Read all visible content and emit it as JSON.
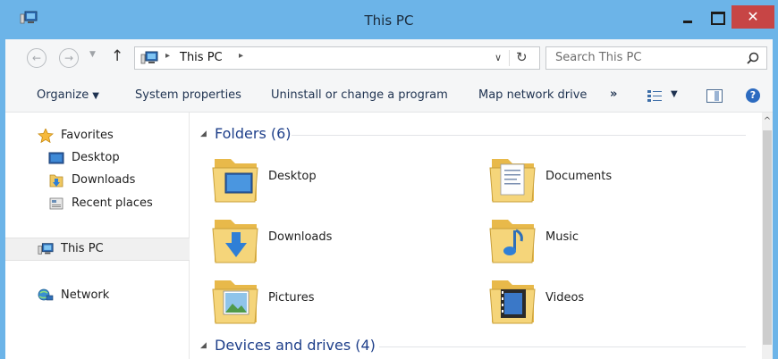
{
  "window": {
    "title": "This PC",
    "close_glyph": "✕",
    "accent_color": "#6cb4e8",
    "close_color": "#c74545"
  },
  "nav": {
    "back_glyph": "←",
    "forward_glyph": "→",
    "recent_glyph": "▼",
    "up_glyph": "↑",
    "address_sep": "▸",
    "address_text": "This PC",
    "address_dropdown_glyph": "∨",
    "refresh_glyph": "↻",
    "search_placeholder": "Search This PC"
  },
  "command_bar": {
    "organize": "Organize",
    "organize_caret": "▼",
    "system_properties": "System properties",
    "uninstall": "Uninstall or change a program",
    "map_drive": "Map network drive",
    "more": "»",
    "view_caret": "▼",
    "help": "?"
  },
  "sidebar": {
    "items": [
      {
        "label": "Favorites",
        "icon": "star-icon"
      },
      {
        "label": "Desktop",
        "icon": "desktop-icon"
      },
      {
        "label": "Downloads",
        "icon": "downloads-icon"
      },
      {
        "label": "Recent places",
        "icon": "recent-places-icon"
      },
      {
        "label": "This PC",
        "icon": "computer-icon",
        "selected": true
      },
      {
        "label": "Network",
        "icon": "network-icon"
      }
    ]
  },
  "content": {
    "collapse_glyph": "◢",
    "groups": [
      {
        "title": "Folders (6)"
      },
      {
        "title": "Devices and drives (4)"
      }
    ],
    "folders": [
      {
        "label": "Desktop",
        "icon": "desktop-folder-icon"
      },
      {
        "label": "Documents",
        "icon": "documents-folder-icon"
      },
      {
        "label": "Downloads",
        "icon": "downloads-folder-icon"
      },
      {
        "label": "Music",
        "icon": "music-folder-icon"
      },
      {
        "label": "Pictures",
        "icon": "pictures-folder-icon"
      },
      {
        "label": "Videos",
        "icon": "videos-folder-icon"
      }
    ]
  },
  "scrollbar": {
    "up_glyph": "^"
  }
}
